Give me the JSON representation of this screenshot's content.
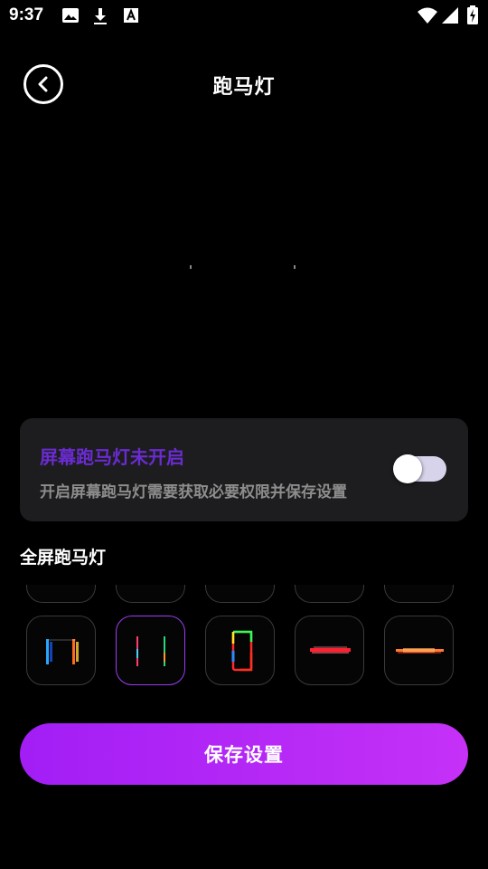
{
  "status_bar": {
    "time": "9:37",
    "icons": [
      "image-icon",
      "download-icon",
      "text-a-icon",
      "wifi-icon",
      "signal-icon",
      "battery-charging-icon"
    ]
  },
  "header": {
    "title": "跑马灯",
    "back_icon": "chevron-left-icon"
  },
  "status_card": {
    "title": "屏幕跑马灯未开启",
    "description": "开启屏幕跑马灯需要获取必要权限并保存设置",
    "toggle_on": false
  },
  "section": {
    "title": "全屏跑马灯"
  },
  "styles": {
    "selected_index": 1,
    "items": [
      "style-1",
      "style-2",
      "style-3",
      "style-4",
      "style-5"
    ]
  },
  "save_button": {
    "label": "保存设置"
  },
  "colors": {
    "accent": "#a21ef5",
    "card_title": "#6a2bd0",
    "card_bg": "#1d1d1f",
    "selected_border": "#9b3df0"
  }
}
